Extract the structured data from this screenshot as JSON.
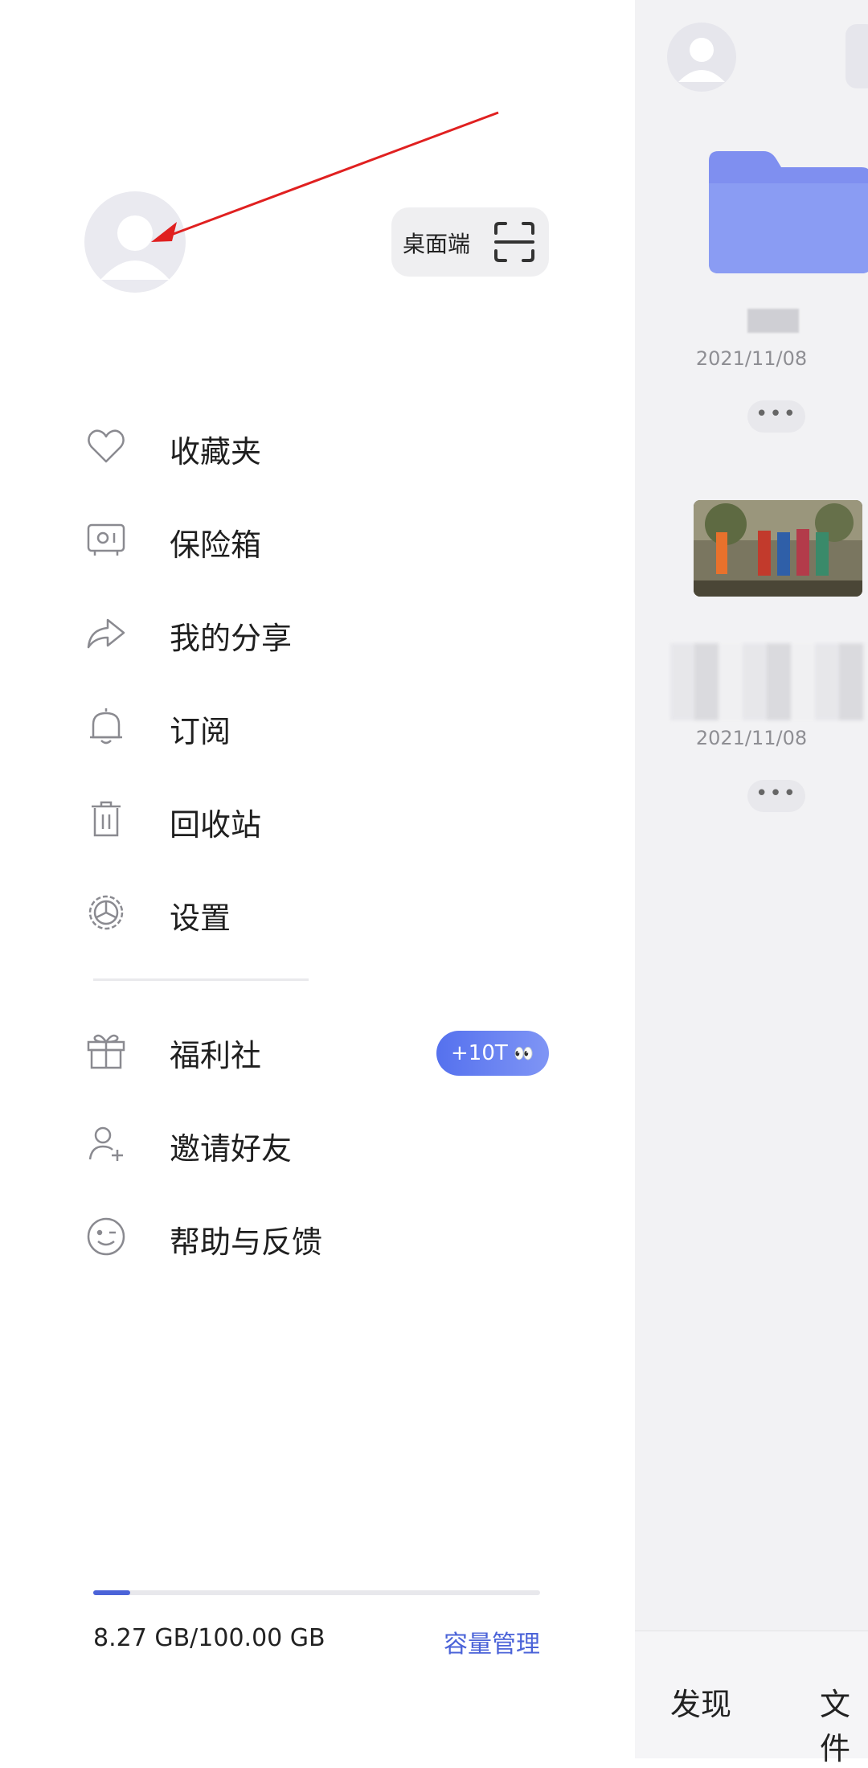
{
  "drawer": {
    "desktop_button": {
      "label": "桌面端"
    },
    "menu": [
      {
        "label": "收藏夹"
      },
      {
        "label": "保险箱"
      },
      {
        "label": "我的分享"
      },
      {
        "label": "订阅"
      },
      {
        "label": "回收站"
      },
      {
        "label": "设置"
      },
      {
        "label": "福利社"
      },
      {
        "label": "邀请好友"
      },
      {
        "label": "帮助与反馈"
      }
    ],
    "welfare_badge": {
      "text": "+10T",
      "emoji": "👀"
    },
    "storage": {
      "used_text": "8.27 GB/100.00 GB",
      "used_fraction": 0.0827,
      "manage_label": "容量管理"
    }
  },
  "background_app": {
    "files": [
      {
        "date": "2021/11/08",
        "more": "•••"
      },
      {
        "date": "2021/11/08",
        "more": "•••"
      }
    ],
    "bottom_tabs": [
      {
        "label": "发现"
      },
      {
        "label": "文件"
      }
    ]
  },
  "colors": {
    "accent": "#4b63d8",
    "badge_gradient_start": "#5571ee",
    "badge_gradient_end": "#7f95f5",
    "annotation_arrow": "#e02020"
  }
}
